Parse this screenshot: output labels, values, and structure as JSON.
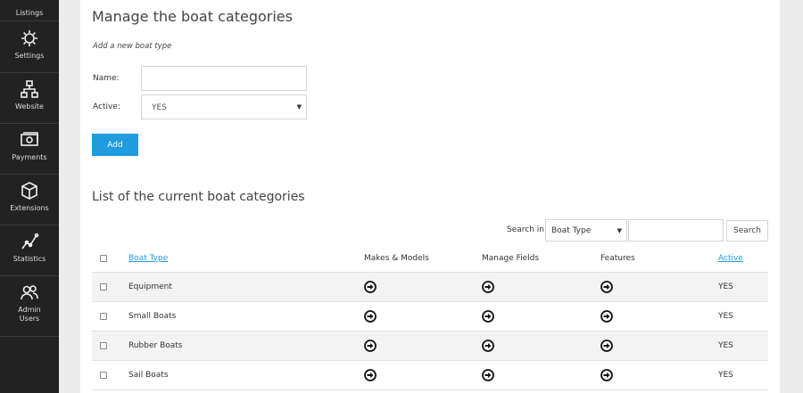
{
  "sidebar": {
    "items": [
      {
        "label": "Listings",
        "icon": "listings-icon"
      },
      {
        "label": "Settings",
        "icon": "gear-icon"
      },
      {
        "label": "Website",
        "icon": "sitemap-icon"
      },
      {
        "label": "Payments",
        "icon": "money-icon"
      },
      {
        "label": "Extensions",
        "icon": "cube-icon"
      },
      {
        "label": "Statistics",
        "icon": "chart-line-icon"
      },
      {
        "label": "Admin Users",
        "icon": "users-icon"
      }
    ]
  },
  "main": {
    "title": "Manage the boat categories",
    "subtitle": "Add a new boat type",
    "form": {
      "name_label": "Name:",
      "name_value": "",
      "active_label": "Active:",
      "active_value": "YES",
      "add_label": "Add"
    },
    "list_title": "List of the current boat categories",
    "search": {
      "label": "Search in",
      "field_value": "Boat Type",
      "input_value": "",
      "button_label": "Search"
    },
    "table": {
      "headers": {
        "boat_type": "Boat Type",
        "makes_models": "Makes & Models",
        "manage_fields": "Manage Fields",
        "features": "Features",
        "active": "Active"
      },
      "rows": [
        {
          "boat_type": "Equipment",
          "active": "YES"
        },
        {
          "boat_type": "Small Boats",
          "active": "YES"
        },
        {
          "boat_type": "Rubber Boats",
          "active": "YES"
        },
        {
          "boat_type": "Sail Boats",
          "active": "YES"
        }
      ],
      "row_action_icon": "arrow-circle-right-icon"
    }
  },
  "colors": {
    "sidebar_bg": "#222222",
    "accent": "#1f9bde",
    "page_bg": "#ececec"
  }
}
